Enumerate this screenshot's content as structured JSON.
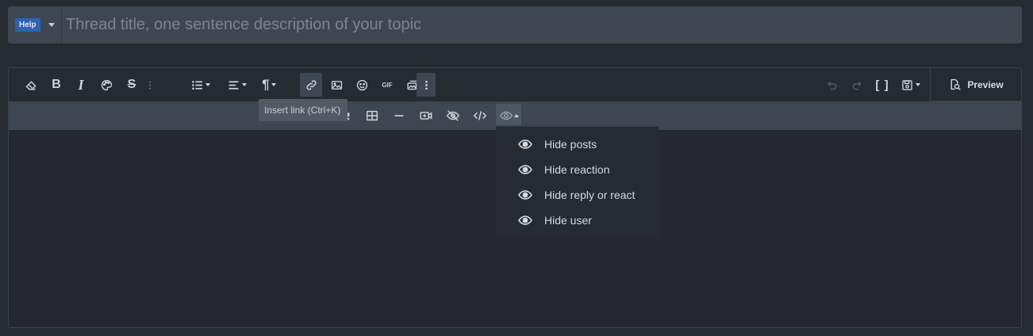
{
  "title_row": {
    "prefix_label": "Help",
    "title_placeholder": "Thread title, one sentence description of your topic"
  },
  "toolbar": {
    "row1": [
      {
        "icon": "eraser-icon",
        "label": ""
      },
      {
        "icon": "bold-icon",
        "label": "B"
      },
      {
        "icon": "italic-icon",
        "label": "I"
      },
      {
        "icon": "palette-icon",
        "label": ""
      },
      {
        "icon": "strikethrough-icon",
        "label": "S"
      },
      {
        "icon": "more-vertical-icon",
        "label": ""
      },
      {
        "icon": "list-icon",
        "label": ""
      },
      {
        "icon": "align-icon",
        "label": ""
      },
      {
        "icon": "paragraph-icon",
        "label": "¶"
      },
      {
        "icon": "link-icon",
        "label": ""
      },
      {
        "icon": "image-icon",
        "label": ""
      },
      {
        "icon": "smiley-icon",
        "label": ""
      },
      {
        "icon": "gif-icon",
        "label": "GIF"
      },
      {
        "icon": "media-icon",
        "label": ""
      },
      {
        "icon": "more-vertical-icon",
        "label": ""
      }
    ],
    "right": {
      "undo_icon": "undo-icon",
      "redo_icon": "redo-icon",
      "brackets_label": "[ ]",
      "drafts_icon": "save-icon"
    },
    "preview_label": "Preview",
    "tooltip": "Insert link (Ctrl+K)"
  },
  "hide_menu": {
    "items": [
      {
        "label": "Hide posts"
      },
      {
        "label": "Hide reaction"
      },
      {
        "label": "Hide reply or react"
      },
      {
        "label": "Hide user"
      }
    ]
  },
  "colors": {
    "background": "#262a31",
    "input_bg": "#3e4652",
    "prefix_blue": "#2b63b0",
    "text": "#c9ced6"
  }
}
